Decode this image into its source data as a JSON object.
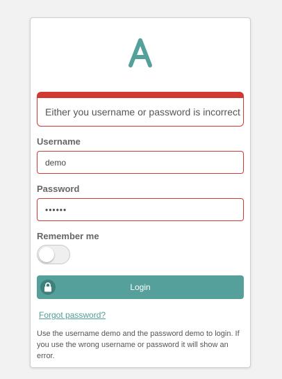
{
  "brand": {
    "logo_icon": "letter-a-logo",
    "accent_color": "#55a09a"
  },
  "alert": {
    "message": "Either you username or password is incorrect",
    "color": "#d13a32"
  },
  "form": {
    "username_label": "Username",
    "username_value": "demo",
    "password_label": "Password",
    "password_value": "••••••",
    "remember_label": "Remember me",
    "remember_checked": false,
    "login_label": "Login",
    "login_icon": "lock-icon"
  },
  "links": {
    "forgot_password": "Forgot password?"
  },
  "hint": {
    "text": "Use the username demo and the password demo to login. If you use the wrong username or password it will show an error."
  }
}
